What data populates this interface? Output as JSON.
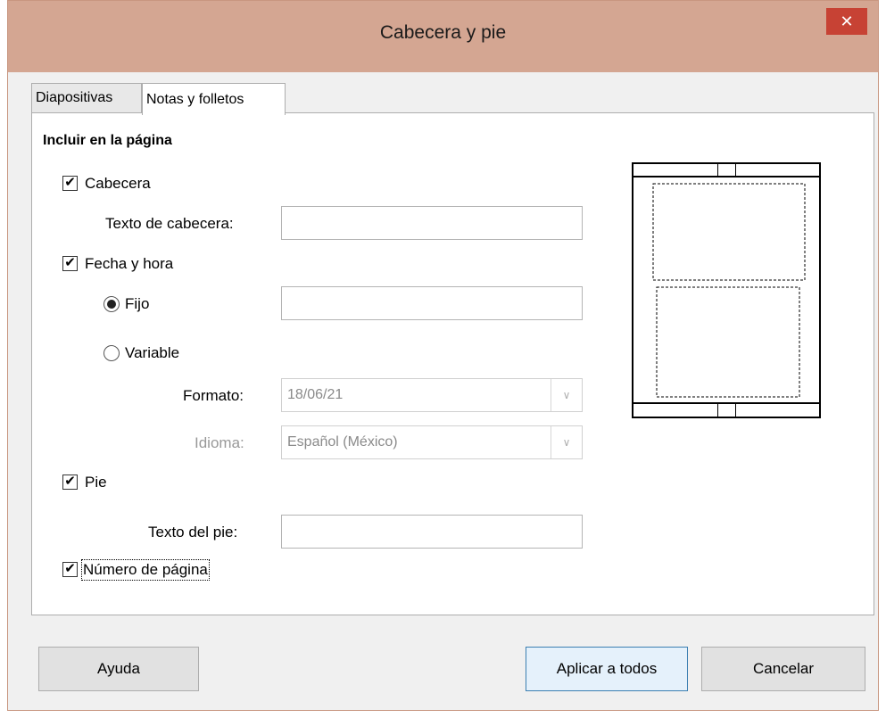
{
  "dialog": {
    "title": "Cabecera y pie",
    "close_symbol": "✕"
  },
  "tabs": [
    {
      "label": "Diapositivas",
      "active": false
    },
    {
      "label": "Notas y folletos",
      "active": true
    }
  ],
  "section": {
    "title": "Incluir en la página"
  },
  "header": {
    "checkbox_label": "Cabecera",
    "checked": true,
    "text_label": "Texto de cabecera:",
    "text_value": ""
  },
  "datetime": {
    "checkbox_label": "Fecha y hora",
    "checked": true,
    "fixed_label": "Fijo",
    "fixed_selected": true,
    "fixed_value": "",
    "variable_label": "Variable",
    "variable_selected": false,
    "format_label": "Formato:",
    "format_value": "18/06/21",
    "language_label": "Idioma:",
    "language_value": "Español (México)"
  },
  "footer": {
    "checkbox_label": "Pie",
    "checked": true,
    "text_label": "Texto del pie:",
    "text_value": ""
  },
  "page_number": {
    "checkbox_label": "Número de página",
    "checked": true
  },
  "buttons": {
    "help": "Ayuda",
    "apply_all": "Aplicar a todos",
    "cancel": "Cancelar"
  },
  "checkmark_symbol": "✔",
  "dropdown_arrow": "∨",
  "colors": {
    "titlebar": "#d4a692",
    "close": "#c74234",
    "default_button_border": "#3c7fb1"
  }
}
